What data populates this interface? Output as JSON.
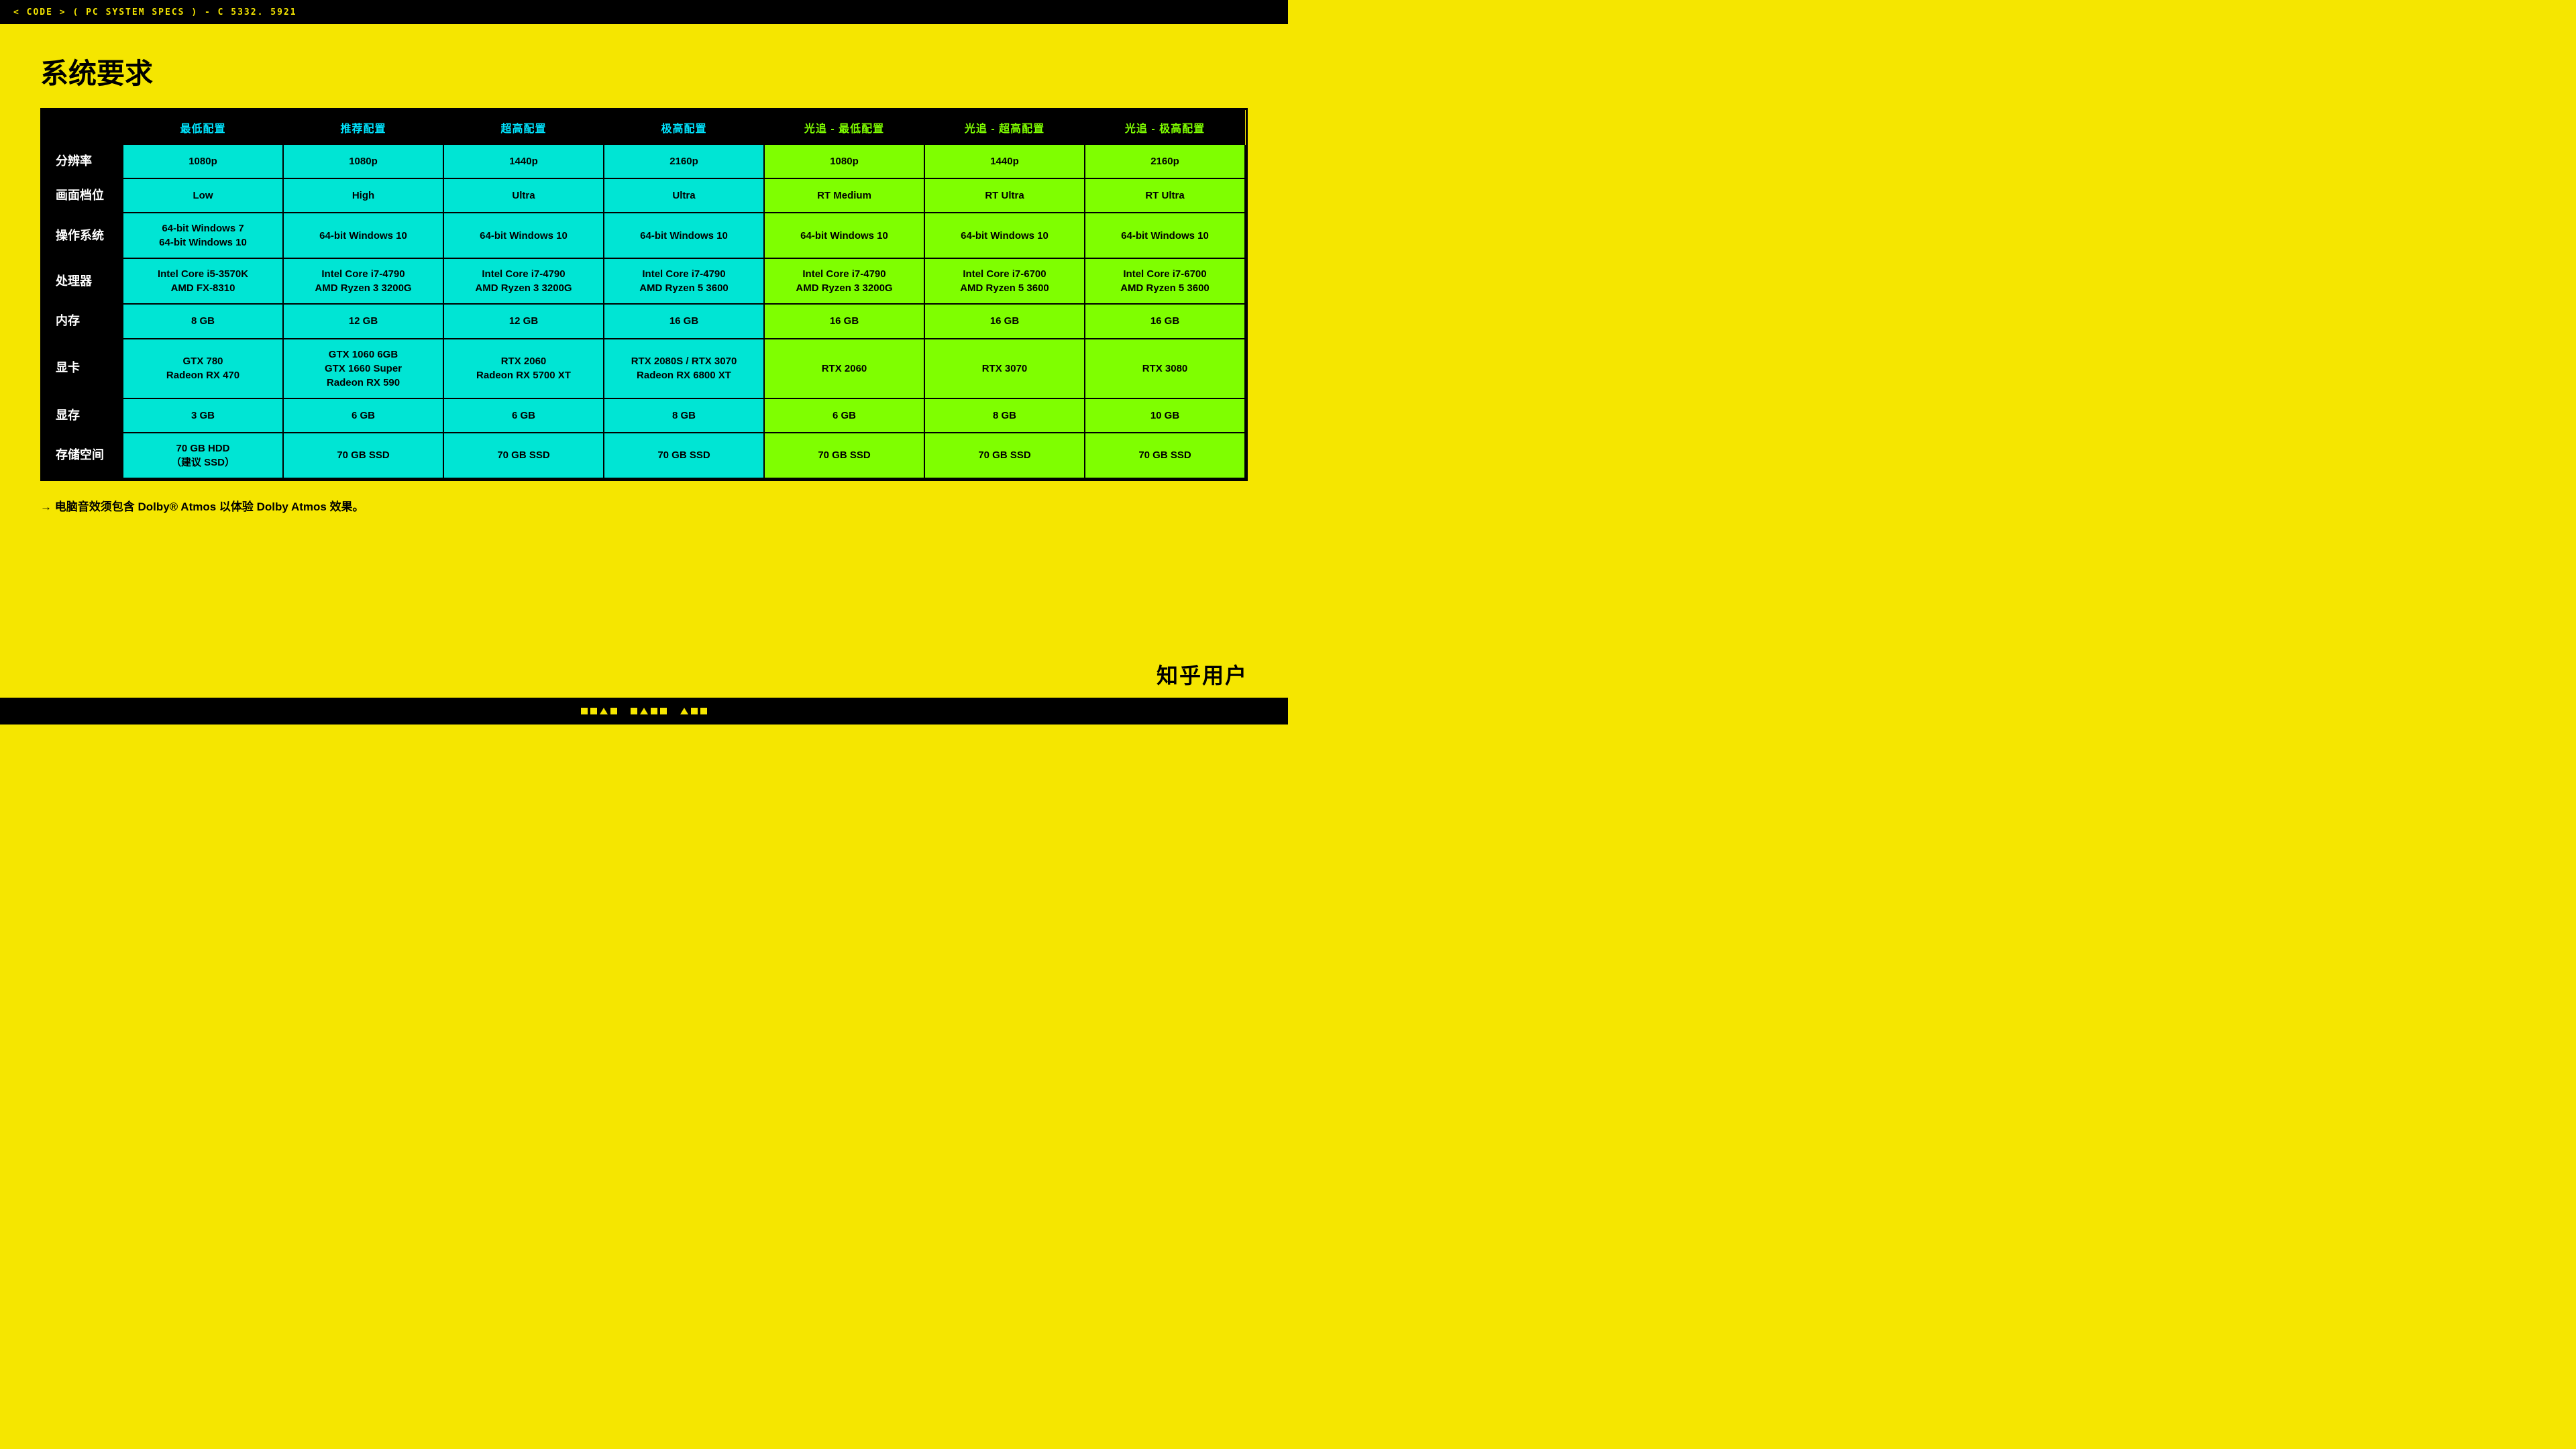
{
  "topbar": {
    "text": "< CODE > ( PC SYSTEM SPECS ) - C 5332. 5921"
  },
  "page": {
    "title": "系统要求"
  },
  "table": {
    "headers": [
      {
        "label": "",
        "type": "empty"
      },
      {
        "label": "最低配置",
        "type": "cyan"
      },
      {
        "label": "推荐配置",
        "type": "cyan"
      },
      {
        "label": "超高配置",
        "type": "cyan"
      },
      {
        "label": "极高配置",
        "type": "cyan"
      },
      {
        "label": "光追 - 最低配置",
        "type": "green"
      },
      {
        "label": "光追 - 超高配置",
        "type": "green"
      },
      {
        "label": "光追 - 极高配置",
        "type": "green"
      }
    ],
    "rows": [
      {
        "label": "分辨率",
        "cells": [
          {
            "value": "1080p",
            "type": "cyan"
          },
          {
            "value": "1080p",
            "type": "cyan"
          },
          {
            "value": "1440p",
            "type": "cyan"
          },
          {
            "value": "2160p",
            "type": "cyan"
          },
          {
            "value": "1080p",
            "type": "green"
          },
          {
            "value": "1440p",
            "type": "green"
          },
          {
            "value": "2160p",
            "type": "green"
          }
        ]
      },
      {
        "label": "画面档位",
        "cells": [
          {
            "value": "Low",
            "type": "cyan"
          },
          {
            "value": "High",
            "type": "cyan"
          },
          {
            "value": "Ultra",
            "type": "cyan"
          },
          {
            "value": "Ultra",
            "type": "cyan"
          },
          {
            "value": "RT Medium",
            "type": "green"
          },
          {
            "value": "RT Ultra",
            "type": "green"
          },
          {
            "value": "RT Ultra",
            "type": "green"
          }
        ]
      },
      {
        "label": "操作系统",
        "cells": [
          {
            "value": "64-bit Windows 7\n64-bit Windows 10",
            "type": "cyan"
          },
          {
            "value": "64-bit Windows 10",
            "type": "cyan"
          },
          {
            "value": "64-bit Windows 10",
            "type": "cyan"
          },
          {
            "value": "64-bit Windows 10",
            "type": "cyan"
          },
          {
            "value": "64-bit Windows 10",
            "type": "green"
          },
          {
            "value": "64-bit Windows 10",
            "type": "green"
          },
          {
            "value": "64-bit Windows 10",
            "type": "green"
          }
        ]
      },
      {
        "label": "处理器",
        "cells": [
          {
            "value": "Intel Core i5-3570K\nAMD FX-8310",
            "type": "cyan"
          },
          {
            "value": "Intel Core i7-4790\nAMD Ryzen 3 3200G",
            "type": "cyan"
          },
          {
            "value": "Intel Core i7-4790\nAMD Ryzen 3 3200G",
            "type": "cyan"
          },
          {
            "value": "Intel Core i7-4790\nAMD Ryzen 5 3600",
            "type": "cyan"
          },
          {
            "value": "Intel Core i7-4790\nAMD Ryzen 3 3200G",
            "type": "green"
          },
          {
            "value": "Intel Core i7-6700\nAMD Ryzen 5 3600",
            "type": "green"
          },
          {
            "value": "Intel Core i7-6700\nAMD Ryzen 5 3600",
            "type": "green"
          }
        ]
      },
      {
        "label": "内存",
        "cells": [
          {
            "value": "8 GB",
            "type": "cyan"
          },
          {
            "value": "12 GB",
            "type": "cyan"
          },
          {
            "value": "12 GB",
            "type": "cyan"
          },
          {
            "value": "16 GB",
            "type": "cyan"
          },
          {
            "value": "16 GB",
            "type": "green"
          },
          {
            "value": "16 GB",
            "type": "green"
          },
          {
            "value": "16 GB",
            "type": "green"
          }
        ]
      },
      {
        "label": "显卡",
        "cells": [
          {
            "value": "GTX 780\nRadeon RX 470",
            "type": "cyan"
          },
          {
            "value": "GTX 1060 6GB\nGTX 1660 Super\nRadeon RX 590",
            "type": "cyan"
          },
          {
            "value": "RTX 2060\nRadeon RX 5700 XT",
            "type": "cyan"
          },
          {
            "value": "RTX 2080S / RTX 3070\nRadeon RX 6800 XT",
            "type": "cyan"
          },
          {
            "value": "RTX 2060",
            "type": "green"
          },
          {
            "value": "RTX 3070",
            "type": "green"
          },
          {
            "value": "RTX 3080",
            "type": "green"
          }
        ]
      },
      {
        "label": "显存",
        "cells": [
          {
            "value": "3 GB",
            "type": "cyan"
          },
          {
            "value": "6 GB",
            "type": "cyan"
          },
          {
            "value": "6 GB",
            "type": "cyan"
          },
          {
            "value": "8 GB",
            "type": "cyan"
          },
          {
            "value": "6 GB",
            "type": "green"
          },
          {
            "value": "8 GB",
            "type": "green"
          },
          {
            "value": "10 GB",
            "type": "green"
          }
        ]
      },
      {
        "label": "存储空间",
        "cells": [
          {
            "value": "70 GB HDD\n（建议 SSD）",
            "type": "cyan"
          },
          {
            "value": "70 GB SSD",
            "type": "cyan"
          },
          {
            "value": "70 GB SSD",
            "type": "cyan"
          },
          {
            "value": "70 GB SSD",
            "type": "cyan"
          },
          {
            "value": "70 GB SSD",
            "type": "green"
          },
          {
            "value": "70 GB SSD",
            "type": "green"
          },
          {
            "value": "70 GB SSD",
            "type": "green"
          }
        ]
      }
    ]
  },
  "footer": {
    "note": "→ 电脑音效须包含 Dolby® Atmos 以体验 Dolby Atmos 效果。"
  },
  "watermark": {
    "text": "知乎用户"
  }
}
